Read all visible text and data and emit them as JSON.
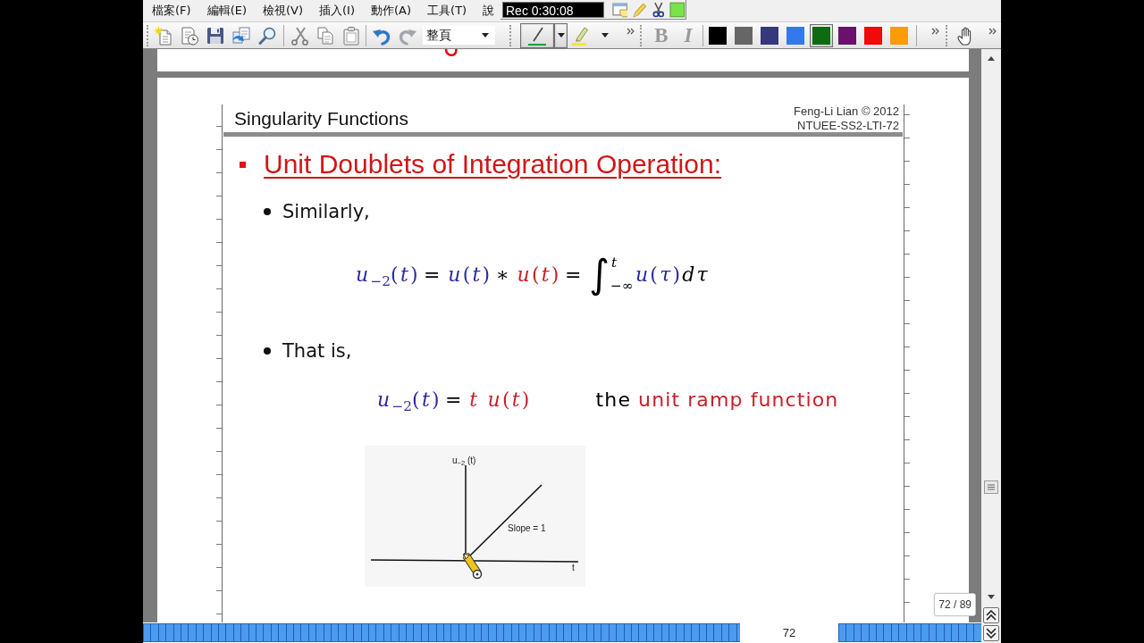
{
  "menu": [
    "檔案(F)",
    "編輯(E)",
    "檢視(V)",
    "插入(I)",
    "動作(A)",
    "工具(T)",
    "說"
  ],
  "recorder": {
    "time": "Rec 0:30:08"
  },
  "toolbar": {
    "undo": {
      "disabled": false
    },
    "redo": {
      "disabled": true
    },
    "zoom_mode": {
      "value": "整頁"
    },
    "pen": {
      "selected": true
    },
    "highlighter": {
      "selected": false
    },
    "bold": {
      "label": "B",
      "disabled": true
    },
    "italic": {
      "label": "I",
      "disabled": true
    },
    "colors": [
      {
        "color": "#000000",
        "selected": false
      },
      {
        "color": "#666666",
        "selected": false
      },
      {
        "color": "#35387a",
        "selected": false
      },
      {
        "color": "#3479ec",
        "selected": false
      },
      {
        "color": "#0f6b12",
        "selected": true
      },
      {
        "color": "#6c106e",
        "selected": false
      },
      {
        "color": "#f00a0a",
        "selected": false
      },
      {
        "color": "#ff9a08",
        "selected": false
      }
    ],
    "hand": {
      "selected": false
    }
  },
  "slide": {
    "title": "Singularity Functions",
    "credit": [
      "Feng-Li Lian © 2012",
      "NTUEE-SS2-LTI-72"
    ],
    "heading": "Unit Doublets of Integration Operation:",
    "blocks": [
      {
        "kind": "bullet",
        "text": "Similarly,"
      },
      {
        "kind": "equation",
        "parts": [
          {
            "kind": "term",
            "text": "*u*$_{−2}$(*t*)",
            "color": "#2b2ba0"
          },
          {
            "kind": "operator",
            "text": "=",
            "color": "#000000"
          },
          {
            "kind": "term",
            "text": "*u*(*t*)",
            "color": "#2b2ba0"
          },
          {
            "kind": "operator",
            "text": "∗",
            "color": "#000000"
          },
          {
            "kind": "term",
            "text": "*u*(*t*)",
            "color": "#c8202a"
          },
          {
            "kind": "operator",
            "text": "=",
            "color": "#000000"
          },
          {
            "kind": "integral",
            "sign": "∫",
            "upper": "t",
            "lower": "−∞",
            "color": "#000000"
          },
          {
            "kind": "term",
            "text": "*u*(*τ*)",
            "color": "#2b2ba0"
          },
          {
            "kind": "variable",
            "text": "dτ",
            "color": "#000000"
          }
        ]
      },
      {
        "kind": "bullet",
        "text": "That is,"
      },
      {
        "kind": "equation",
        "parts": [
          {
            "kind": "term",
            "text": "*u*$_{−2}$(*t*)",
            "color": "#2b2ba0"
          },
          {
            "kind": "operator",
            "text": "=",
            "color": "#000000"
          },
          {
            "kind": "term",
            "text": "*t* *u*(*t*)",
            "color": "#c8202a"
          }
        ],
        "note": [
          {
            "text": "the",
            "color": "#000000"
          },
          {
            "text": "unit ramp function",
            "color": "#c8202a"
          }
        ]
      },
      {
        "kind": "figure",
        "y_label": "u$_{−2}$ (t)",
        "annotation": "Slope = 1",
        "x_label": "t"
      }
    ]
  },
  "page_number": "72",
  "page_counter": "72 / 89"
}
